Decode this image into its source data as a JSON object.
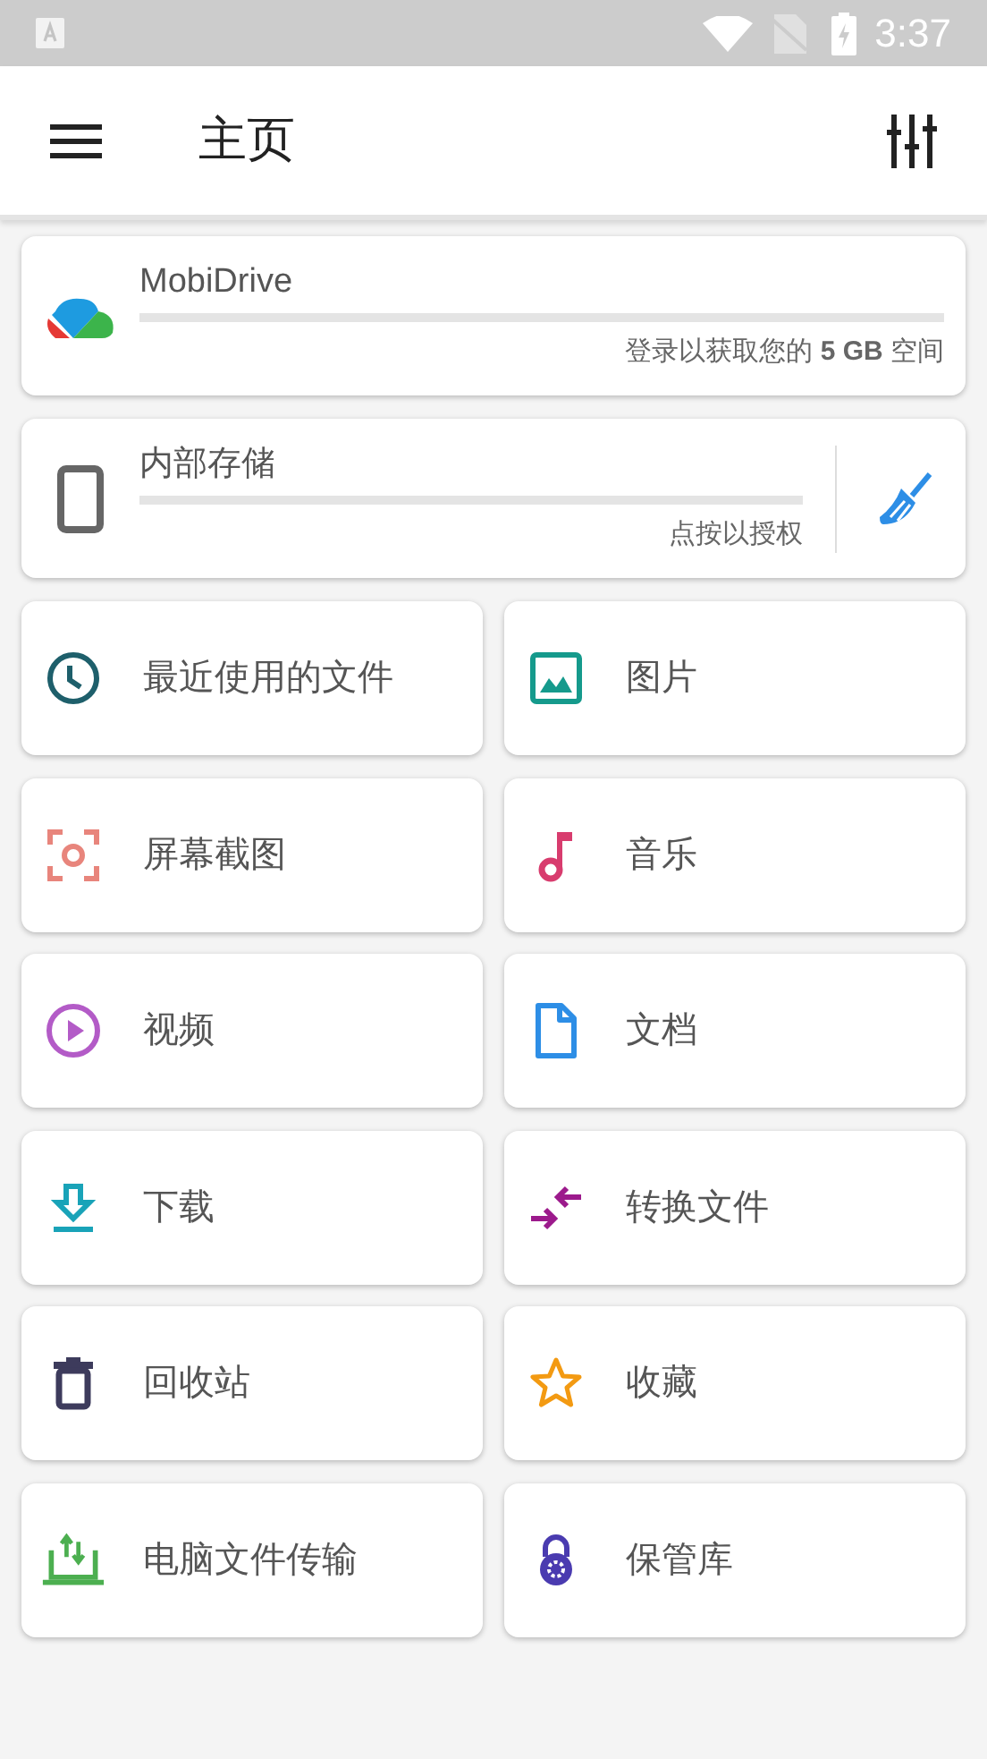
{
  "status_bar": {
    "time": "3:37"
  },
  "app_bar": {
    "title": "主页"
  },
  "storage": [
    {
      "kind": "cloud",
      "name": "MobiDrive",
      "level": 0,
      "caption": "登录以获取您的 **5 GB** 空间"
    },
    {
      "kind": "phone",
      "name": "内部存储",
      "level": 0,
      "caption": "点按以授权"
    }
  ],
  "tiles": [
    {
      "kind": "recent",
      "label": "最近使用的文件",
      "color": "#1e5f6b"
    },
    {
      "kind": "images",
      "label": "图片",
      "color": "#159a8c"
    },
    {
      "kind": "screenshot",
      "label": "屏幕截图",
      "color": "#e8857c"
    },
    {
      "kind": "music",
      "label": "音乐",
      "color": "#d83c6e"
    },
    {
      "kind": "video",
      "label": "视频",
      "color": "#b35bc7"
    },
    {
      "kind": "document",
      "label": "文档",
      "color": "#2d8ee6"
    },
    {
      "kind": "download",
      "label": "下载",
      "color": "#19a3b8"
    },
    {
      "kind": "convert",
      "label": "转换文件",
      "color": "#9c1a8c"
    },
    {
      "kind": "trash",
      "label": "回收站",
      "color": "#3d3b5c"
    },
    {
      "kind": "favorite",
      "label": "收藏",
      "color": "#f39a12"
    },
    {
      "kind": "pc_transfer",
      "label": "电脑文件传输",
      "color": "#4caf50"
    },
    {
      "kind": "vault",
      "label": "保管库",
      "color": "#4a3bb0"
    }
  ]
}
